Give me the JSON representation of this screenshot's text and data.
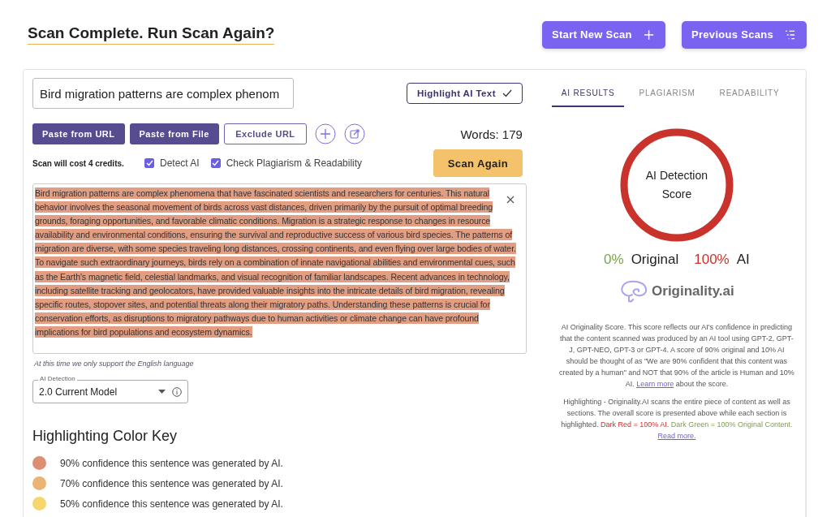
{
  "header": {
    "title": "Scan Complete. Run Scan Again?",
    "buttons": [
      {
        "label": "Start New Scan",
        "kind": "plus"
      },
      {
        "label": "Previous Scans",
        "kind": "list"
      }
    ]
  },
  "title_field": {
    "value": "Bird migration patterns are complex phenom"
  },
  "highlight_button": {
    "label": "Highlight AI Text",
    "checked": true
  },
  "source_buttons": [
    {
      "label": "Paste from URL",
      "kind": "filled"
    },
    {
      "label": "Paste from File",
      "kind": "filled"
    },
    {
      "label": "Exclude URL",
      "kind": "outline"
    }
  ],
  "word_count": "Words: 179",
  "cost_note": "Scan will cost 4 credits.",
  "options": [
    {
      "label": "Detect AI",
      "checked": true
    },
    {
      "label": "Check Plagiarism & Readability",
      "checked": true
    }
  ],
  "scan_button": "Scan Again",
  "content": {
    "segments": [
      {
        "text": "Bird migration patterns are complex phenomena that have fascinated scientists and researchers for centuries. This natural behavior involves the seasonal movement of birds across vast distances, driven primarily by the pursuit of optimal breeding grounds, foraging opportunities, and favorable climatic conditions. Migration is a strategic response to changes in resource availability and environmental conditions, ensuring the survival and reproductive success of various bird species. The patterns of migration are diverse, with some species traveling long distances, crossing continents, and even flying over large bodies of water. To navigate such extraordinary journeys, birds rely on a combination of innate navigational abilities and environmental cues, such as the Earth's magnetic field, celestial landmarks, and visual recognition of familiar landscapes. Recent advances in technology, including satellite tracking and geolocators, have provided valuable insights into the intricate details of bird migration, revealing specific routes, stopover sites, and potential threats along their migratory paths. Understanding these patterns is crucial for conservation efforts, as disruptions to migratory pathways due to human activities or climate change can have profound implications for bird populations and ecosystem dynamics.",
        "color": "#e29e83"
      }
    ]
  },
  "language_note": "At this time we only support the English language",
  "model_select": {
    "label": "AI Detection",
    "value": "2.0 Current Model"
  },
  "color_key": {
    "title": "Highlighting Color Key",
    "items": [
      {
        "text": "90% confidence this sentence was generated by AI.",
        "color": "#dc8f73"
      },
      {
        "text": "70% confidence this sentence was generated by AI.",
        "color": "#ebb474"
      },
      {
        "text": "50% confidence this sentence was generated by AI.",
        "color": "#f6d66e"
      }
    ]
  },
  "tabs": [
    {
      "label": "AI RESULTS",
      "selected": true
    },
    {
      "label": "PLAGIARISM",
      "selected": false
    },
    {
      "label": "READABILITY",
      "selected": false
    }
  ],
  "score": {
    "label": "AI Detection Score",
    "original_value": "0%",
    "original_label": "Original",
    "ai_value": "100%",
    "ai_label": "AI",
    "level": 1
  },
  "brand": "Originality.ai",
  "explanation": [
    {
      "kind": "text",
      "text": "AI Originality Score. This score reflects our AI's confidence in predicting that the content scanned was produced by an AI tool using GPT-2, GPT-J, GPT-NEO, GPT-3 or GPT-4. A score of 90% original and 10% AI should be thought of as \"We are 90% confident that this content was created by a human\" and NOT that 90% of the article is Human and 10% AI. "
    },
    {
      "kind": "link",
      "text": "Learn more"
    },
    {
      "kind": "text",
      "text": " about the score."
    }
  ],
  "highlight_note": [
    {
      "kind": "text",
      "text": "Highlighting - Originality.AI scans the entire piece of content as well as sections. The overall score is presented above while each section is highlighted. "
    },
    {
      "kind": "red",
      "text": "Dark Red = 100% AI. "
    },
    {
      "kind": "green",
      "text": "Dark Green = 100% Original Content. "
    },
    {
      "kind": "link",
      "text": "Read more."
    }
  ]
}
